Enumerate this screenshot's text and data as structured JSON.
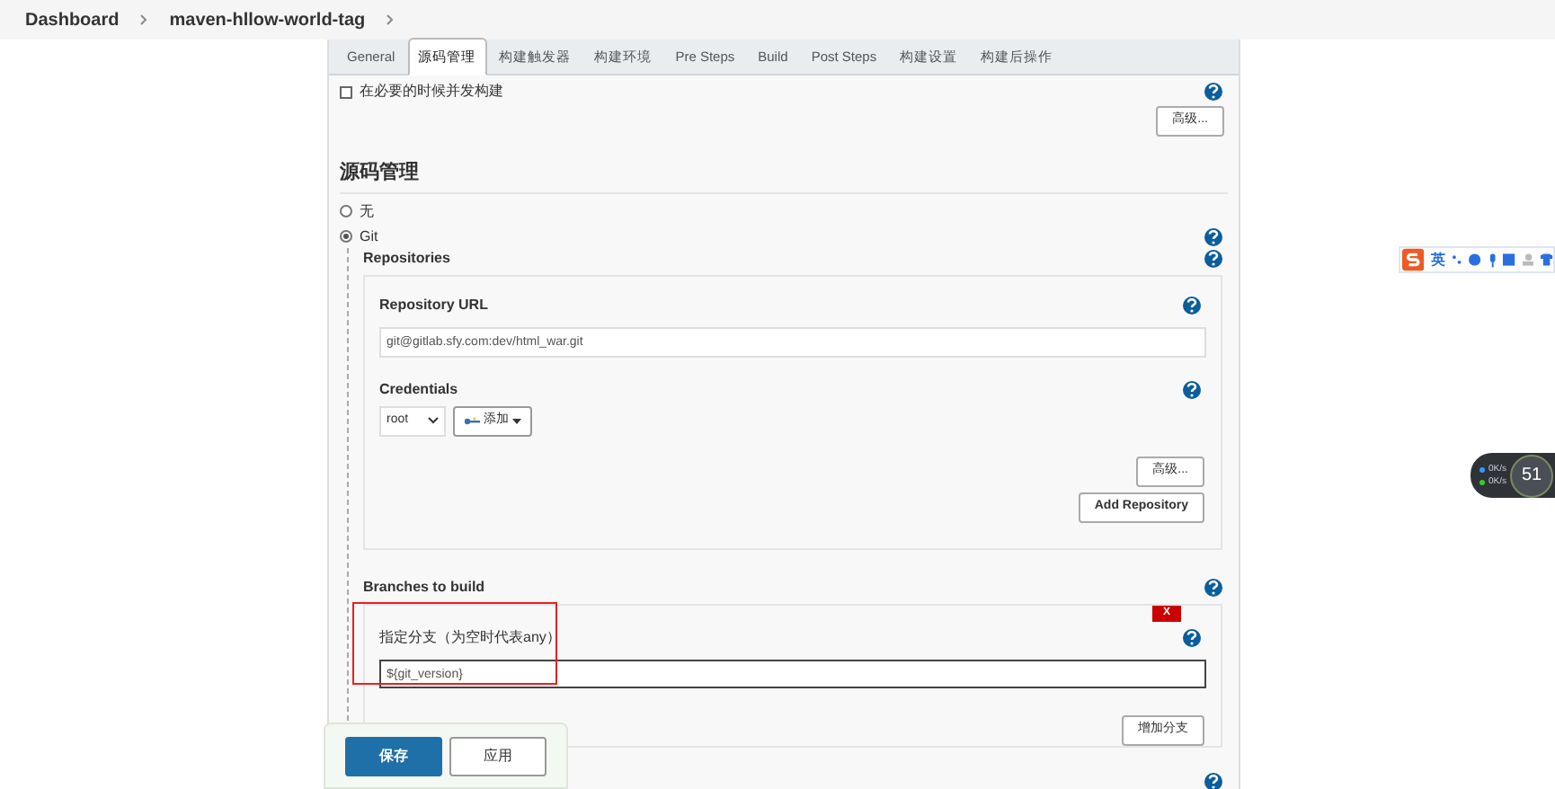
{
  "breadcrumb": [
    {
      "label": "Dashboard"
    },
    {
      "label": "maven-hllow-world-tag"
    }
  ],
  "tabs": [
    {
      "label": "General",
      "selected": false
    },
    {
      "label": "源码管理",
      "selected": true
    },
    {
      "label": "构建触发器",
      "selected": false
    },
    {
      "label": "构建环境",
      "selected": false
    },
    {
      "label": "Pre Steps",
      "selected": false
    },
    {
      "label": "Build",
      "selected": false
    },
    {
      "label": "Post Steps",
      "selected": false
    },
    {
      "label": "构建设置",
      "selected": false
    },
    {
      "label": "构建后操作",
      "selected": false
    }
  ],
  "concurrent_build": {
    "label": "在必要的时候并发构建",
    "checked": false
  },
  "advanced_button": "高级...",
  "section_title": "源码管理",
  "scm_options": [
    {
      "label": "无",
      "selected": false
    },
    {
      "label": "Git",
      "selected": true
    }
  ],
  "repositories": {
    "title": "Repositories",
    "url_label": "Repository URL",
    "url_value": "git@gitlab.sfy.com:dev/html_war.git",
    "credentials_label": "Credentials",
    "credentials_value": "root",
    "add_credentials_button": "添加",
    "advanced_button": "高级...",
    "add_repository_button": "Add Repository"
  },
  "branches": {
    "title": "Branches to build",
    "delete_button": "X",
    "specifier_label": "指定分支（为空时代表any）",
    "specifier_value": "${git_version}",
    "add_branch_button": "增加分支"
  },
  "footer_buttons": [
    {
      "label": "保存",
      "kind": "primary"
    },
    {
      "label": "应用",
      "kind": "secondary"
    }
  ],
  "ime_toolbar": {
    "mode": "英"
  },
  "speed_widget": {
    "value": "51",
    "rates": [
      "0K/s",
      "0K/s"
    ]
  }
}
